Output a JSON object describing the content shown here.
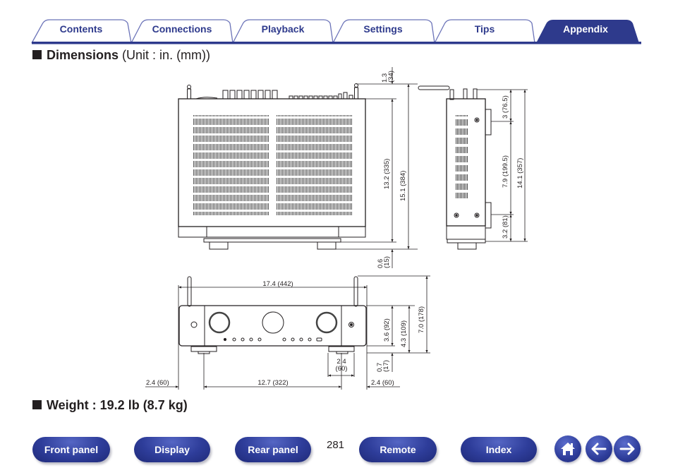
{
  "tabs": [
    {
      "label": "Contents",
      "active": false
    },
    {
      "label": "Connections",
      "active": false
    },
    {
      "label": "Playback",
      "active": false
    },
    {
      "label": "Settings",
      "active": false
    },
    {
      "label": "Tips",
      "active": false
    },
    {
      "label": "Appendix",
      "active": true
    }
  ],
  "colors": {
    "brand_blue": "#2e3a8c",
    "tab_outline": "#6b73b8",
    "text": "#231f20"
  },
  "dimensions_section": {
    "title_bold": "Dimensions",
    "title_regular": "(Unit : in. (mm))"
  },
  "weight_section": {
    "text": "Weight : 19.2 lb (8.7 kg)"
  },
  "top_view": {
    "dims": {
      "antenna_top": "1.3 (34)",
      "body_depth": "13.2 (335)",
      "total_depth": "15.1 (384)",
      "foot_offset": "0.6 (15)"
    }
  },
  "side_view": {
    "dims": {
      "top_section": "3 (76.5)",
      "middle_section": "7.9 (199.5)",
      "bottom_section": "3.2 (81)",
      "total_depth": "14.1 (357)"
    }
  },
  "front_view": {
    "dims": {
      "width": "17.4 (442)",
      "body_height": "3.6 (92)",
      "height_with_feet": "4.3 (109)",
      "height_with_antenna": "7.0 (178)",
      "foot_height": "0.7 (17)",
      "foot_width_value": "2.4",
      "foot_width_mm": "(60)",
      "left_offset": "2.4 (60)",
      "foot_span": "12.7 (322)",
      "right_offset": "2.4 (60)"
    }
  },
  "page_number": "281",
  "bottom_nav": {
    "buttons": [
      "Front panel",
      "Display",
      "Rear panel",
      "Remote",
      "Index"
    ],
    "icons": [
      "home-icon",
      "back-arrow-icon",
      "forward-arrow-icon"
    ]
  }
}
